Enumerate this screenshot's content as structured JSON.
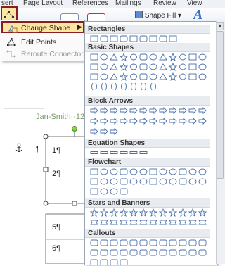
{
  "ribbon": {
    "tabs": [
      "sert",
      "Page Layout",
      "References",
      "Mailings",
      "Review",
      "View"
    ],
    "shape_fill_label": "Shape Fill"
  },
  "submenu": {
    "items": [
      {
        "label": "Change Shape",
        "enabled": true
      },
      {
        "label": "Edit Points",
        "enabled": true
      },
      {
        "label": "Reroute Connectors",
        "enabled": false
      }
    ]
  },
  "shape_panel": {
    "sections": [
      "Rectangles",
      "Basic Shapes",
      "Block Arrows",
      "Equation Shapes",
      "Flowchart",
      "Stars and Banners",
      "Callouts"
    ]
  },
  "document": {
    "comment": "Jan-Smith··12",
    "cells": [
      "1¶",
      "2¶",
      "5¶",
      "6¶"
    ],
    "para_mark": "¶"
  },
  "colors": {
    "highlight": "#fce6a2",
    "highlight_border": "#8a1e1e",
    "icon_stroke": "#4a6fa8"
  }
}
